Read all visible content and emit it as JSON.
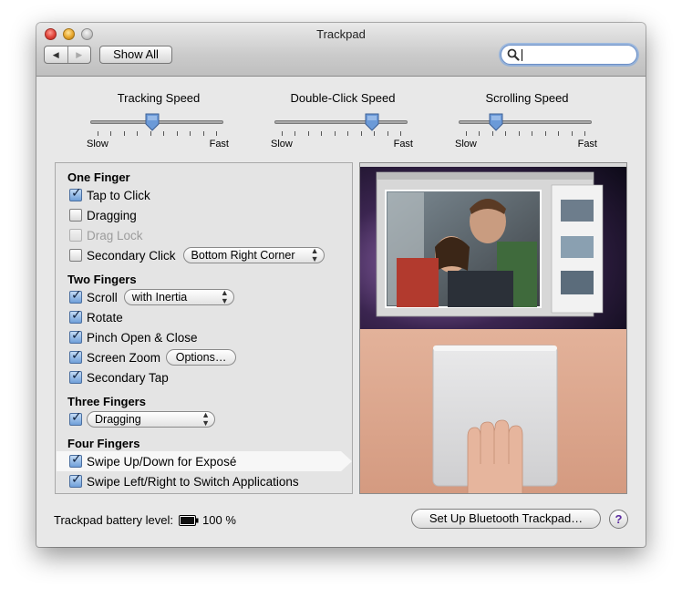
{
  "window": {
    "title": "Trackpad"
  },
  "toolbar": {
    "back_glyph": "◀",
    "forward_glyph": "▶",
    "show_all_label": "Show All",
    "search_value": ""
  },
  "sliders": [
    {
      "title": "Tracking Speed",
      "min_label": "Slow",
      "max_label": "Fast",
      "level": 0.46
    },
    {
      "title": "Double-Click Speed",
      "min_label": "Slow",
      "max_label": "Fast",
      "level": 0.76
    },
    {
      "title": "Scrolling Speed",
      "min_label": "Slow",
      "max_label": "Fast",
      "level": 0.25
    }
  ],
  "sections": {
    "one_finger": {
      "title": "One Finger",
      "tap_to_click": {
        "label": "Tap to Click",
        "checked": true
      },
      "dragging": {
        "label": "Dragging",
        "checked": false
      },
      "drag_lock": {
        "label": "Drag Lock",
        "checked": false,
        "enabled": false
      },
      "secondary_click": {
        "label": "Secondary Click",
        "checked": false,
        "option": "Bottom Right Corner"
      }
    },
    "two_fingers": {
      "title": "Two Fingers",
      "scroll": {
        "label": "Scroll",
        "checked": true,
        "option": "with Inertia"
      },
      "rotate": {
        "label": "Rotate",
        "checked": true
      },
      "pinch": {
        "label": "Pinch Open & Close",
        "checked": true
      },
      "screen_zoom": {
        "label": "Screen Zoom",
        "checked": true,
        "button": "Options…"
      },
      "secondary_tap": {
        "label": "Secondary Tap",
        "checked": true
      }
    },
    "three_fingers": {
      "title": "Three Fingers",
      "gesture": {
        "checked": true,
        "option": "Dragging"
      }
    },
    "four_fingers": {
      "title": "Four Fingers",
      "swipe_up_down": {
        "label": "Swipe Up/Down for Exposé",
        "checked": true,
        "selected": true
      },
      "swipe_left_right": {
        "label": "Swipe Left/Right to Switch Applications",
        "checked": true
      }
    }
  },
  "footer": {
    "battery_label": "Trackpad battery level:",
    "battery_value": "100 %",
    "setup_button": "Set Up Bluetooth Trackpad…",
    "help_glyph": "?"
  },
  "colors": {
    "window_bg": "#e8e8e8",
    "checkbox_checked": "#6f9fd9",
    "slider_knob": "#5b8ed4",
    "help_glyph": "#5b2aa0"
  }
}
